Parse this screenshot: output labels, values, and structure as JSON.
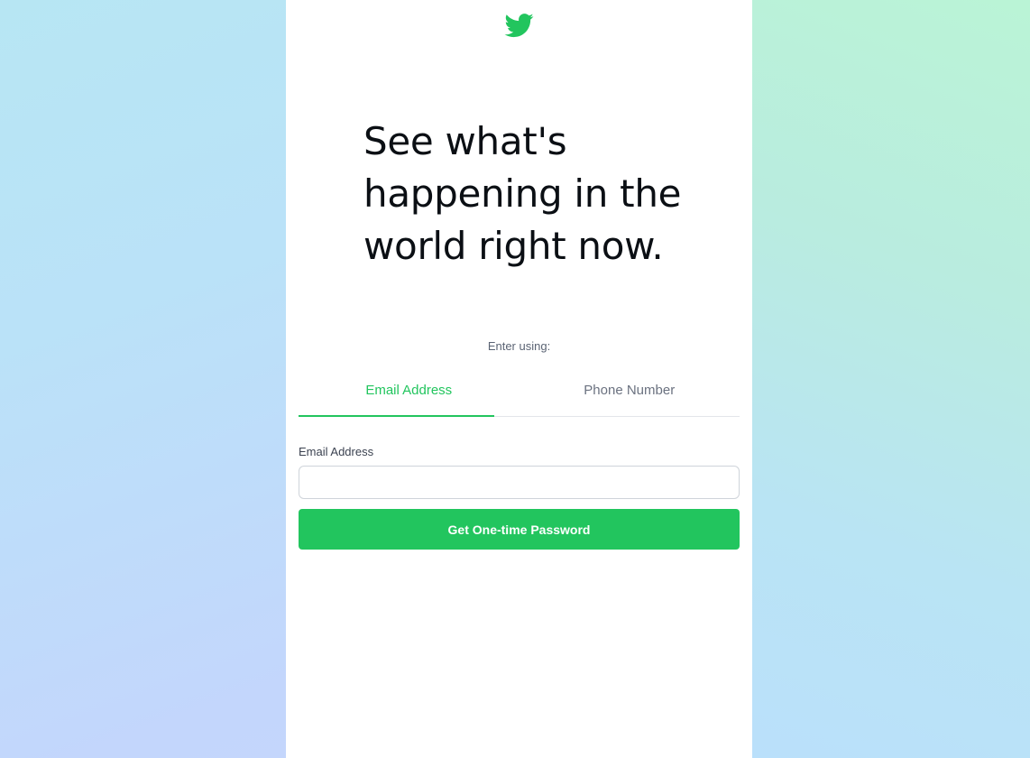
{
  "brand": {
    "icon": "bird-logo-icon",
    "accent_color": "#22c55e"
  },
  "hero": {
    "headline": "See what's happening in the world right now."
  },
  "login": {
    "enter_using_label": "Enter using:",
    "tabs": [
      {
        "label": "Email Address",
        "active": true
      },
      {
        "label": "Phone Number",
        "active": false
      }
    ],
    "field_label": "Email Address",
    "field_value": "",
    "field_placeholder": "",
    "submit_label": "Get One-time Password"
  }
}
